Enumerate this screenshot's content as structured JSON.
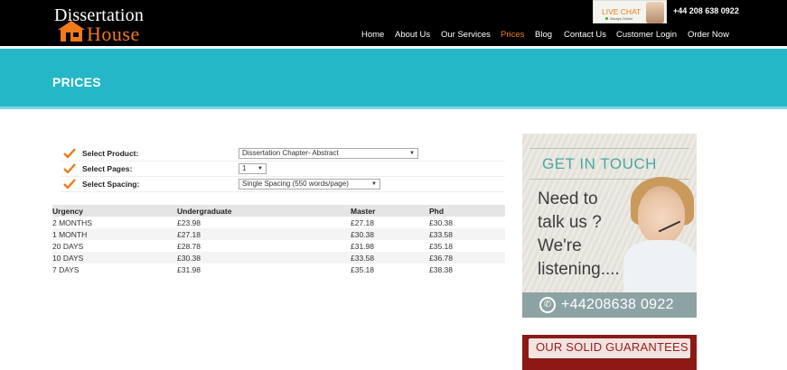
{
  "header": {
    "logo": {
      "line1": "Dissertation",
      "line2": "House"
    },
    "live_chat": {
      "label": "LIVE CHAT",
      "status": "Always Online"
    },
    "phone": "+44 208 638 0922",
    "nav": [
      {
        "label": "Home",
        "active": false
      },
      {
        "label": "About Us",
        "active": false
      },
      {
        "label": "Our Services",
        "active": false
      },
      {
        "label": "Prices",
        "active": true
      },
      {
        "label": "Blog",
        "active": false
      },
      {
        "label": "Contact Us",
        "active": false
      },
      {
        "label": "Customer Login",
        "active": false
      },
      {
        "label": "Order Now",
        "active": false
      }
    ]
  },
  "banner": {
    "title": "PRICES"
  },
  "form": {
    "product": {
      "label": "Select Product:",
      "value": "Dissertation Chapter- Abstract"
    },
    "pages": {
      "label": "Select Pages:",
      "value": "1"
    },
    "spacing": {
      "label": "Select Spacing:",
      "value": "Single Spacing (550 words/page)"
    }
  },
  "table": {
    "headers": [
      "Urgency",
      "Undergraduate",
      "Master",
      "Phd"
    ],
    "rows": [
      [
        "2 MONTHS",
        "£23.98",
        "£27.18",
        "£30.38"
      ],
      [
        "1 MONTH",
        "£27.18",
        "£30.38",
        "£33.58"
      ],
      [
        "20 DAYS",
        "£28.78",
        "£31.98",
        "£35.18"
      ],
      [
        "10 DAYS",
        "£30.38",
        "£33.58",
        "£36.78"
      ],
      [
        "7 DAYS",
        "£31.98",
        "£35.18",
        "£38.38"
      ]
    ]
  },
  "sidebar": {
    "contact": {
      "heading": "GET IN TOUCH",
      "lines": [
        "Need to",
        "talk us ?",
        "We're",
        "listening...."
      ],
      "phone": "+44208638 0922"
    },
    "guarantee": {
      "heading": "OUR SOLID GUARANTEES"
    }
  },
  "colors": {
    "accent": "#f07a1a",
    "banner": "#24b7c8",
    "header": "#000000"
  }
}
